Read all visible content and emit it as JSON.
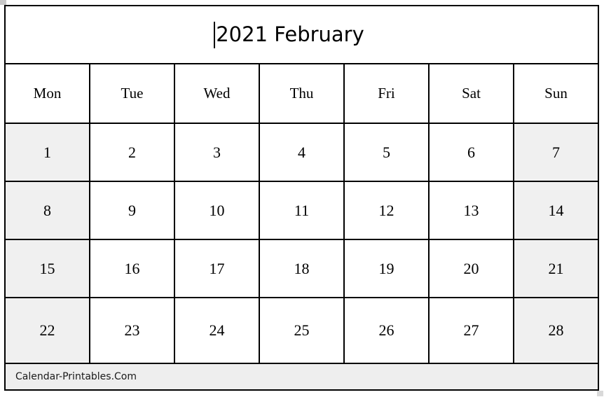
{
  "document": {
    "type": "calendar",
    "caret_visible": true,
    "colors": {
      "border": "#000000",
      "page_background": "#ffffff",
      "weekend_shade": "#f0f0f0",
      "footer_background": "#eeeeee",
      "text": "#000000"
    }
  },
  "title": {
    "text": "2021 February",
    "year": "2021",
    "month": "February"
  },
  "weekdays": [
    {
      "label": "Mon",
      "shaded": true
    },
    {
      "label": "Tue",
      "shaded": false
    },
    {
      "label": "Wed",
      "shaded": false
    },
    {
      "label": "Thu",
      "shaded": false
    },
    {
      "label": "Fri",
      "shaded": false
    },
    {
      "label": "Sat",
      "shaded": false
    },
    {
      "label": "Sun",
      "shaded": true
    }
  ],
  "weeks": [
    {
      "days": [
        {
          "label": "1",
          "shaded": true
        },
        {
          "label": "2",
          "shaded": false
        },
        {
          "label": "3",
          "shaded": false
        },
        {
          "label": "4",
          "shaded": false
        },
        {
          "label": "5",
          "shaded": false
        },
        {
          "label": "6",
          "shaded": false
        },
        {
          "label": "7",
          "shaded": true
        }
      ]
    },
    {
      "days": [
        {
          "label": "8",
          "shaded": true
        },
        {
          "label": "9",
          "shaded": false
        },
        {
          "label": "10",
          "shaded": false
        },
        {
          "label": "11",
          "shaded": false
        },
        {
          "label": "12",
          "shaded": false
        },
        {
          "label": "13",
          "shaded": false
        },
        {
          "label": "14",
          "shaded": true
        }
      ]
    },
    {
      "days": [
        {
          "label": "15",
          "shaded": true
        },
        {
          "label": "16",
          "shaded": false
        },
        {
          "label": "17",
          "shaded": false
        },
        {
          "label": "18",
          "shaded": false
        },
        {
          "label": "19",
          "shaded": false
        },
        {
          "label": "20",
          "shaded": false
        },
        {
          "label": "21",
          "shaded": true
        }
      ]
    },
    {
      "days": [
        {
          "label": "22",
          "shaded": true
        },
        {
          "label": "23",
          "shaded": false
        },
        {
          "label": "24",
          "shaded": false
        },
        {
          "label": "25",
          "shaded": false
        },
        {
          "label": "26",
          "shaded": false
        },
        {
          "label": "27",
          "shaded": false
        },
        {
          "label": "28",
          "shaded": true
        }
      ]
    }
  ],
  "footer": {
    "text": "Calendar-Printables.Com"
  }
}
